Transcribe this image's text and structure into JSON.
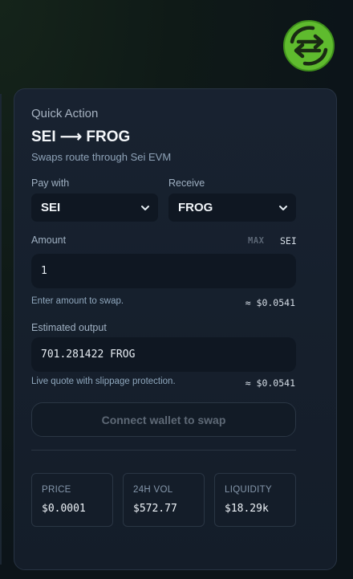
{
  "logo": {
    "icon": "swap-arrows-logo-icon",
    "color": "#5fbb2e"
  },
  "card": {
    "eyebrow": "Quick Action",
    "title": "SEI ⟶ FROG",
    "subtitle": "Swaps route through Sei EVM"
  },
  "pay": {
    "label": "Pay with",
    "value": "SEI",
    "options": [
      "SEI"
    ]
  },
  "receive": {
    "label": "Receive",
    "value": "FROG",
    "options": [
      "FROG"
    ]
  },
  "amount": {
    "label": "Amount",
    "max_label": "MAX",
    "unit": "SEI",
    "value": "1",
    "hint": "Enter amount to swap.",
    "usd": "≈ $0.0541"
  },
  "output": {
    "label": "Estimated output",
    "value": "701.281422 FROG",
    "hint": "Live quote with slippage protection.",
    "usd": "≈ $0.0541"
  },
  "connect_button": "Connect wallet to swap",
  "stats": [
    {
      "label": "PRICE",
      "value": "$0.0001"
    },
    {
      "label": "24H VOL",
      "value": "$572.77"
    },
    {
      "label": "LIQUIDITY",
      "value": "$18.29k"
    }
  ],
  "colors": {
    "accent": "#5fbb2e",
    "card_bg": "#182230",
    "input_bg": "#0f1722",
    "border": "#273343"
  }
}
